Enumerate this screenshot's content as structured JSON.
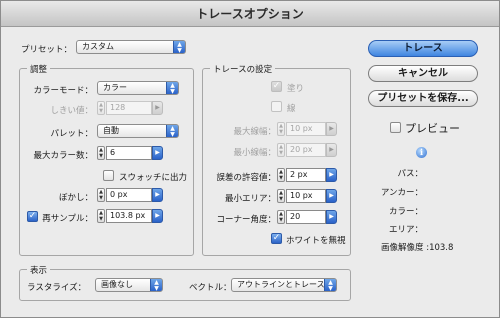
{
  "window": {
    "title": "トレースオプション"
  },
  "preset": {
    "label": "プリセット：",
    "value": "カスタム"
  },
  "adjust": {
    "title": "調整",
    "color_mode": {
      "label": "カラーモード：",
      "value": "カラー"
    },
    "threshold": {
      "label": "しきい値：",
      "value": "128"
    },
    "palette": {
      "label": "パレット：",
      "value": "自動"
    },
    "max_colors": {
      "label": "最大カラー数：",
      "value": "6"
    },
    "swatch_output": {
      "label": "スウォッチに出力",
      "checked": false
    },
    "blur": {
      "label": "ぼかし：",
      "value": "0 px"
    },
    "resample": {
      "label": "再サンプル：",
      "value": "103.8 px",
      "checked": true
    }
  },
  "trace_settings": {
    "title": "トレースの設定",
    "fill": {
      "label": "塗り",
      "checked": true
    },
    "stroke": {
      "label": "線",
      "checked": false
    },
    "max_stroke_weight": {
      "label": "最大線幅：",
      "value": "10 px"
    },
    "min_stroke_length": {
      "label": "最小線幅：",
      "value": "20 px"
    },
    "path_fitting": {
      "label": "誤差の許容値：",
      "value": "2 px"
    },
    "min_area": {
      "label": "最小エリア：",
      "value": "10 px"
    },
    "corner_angle": {
      "label": "コーナー角度：",
      "value": "20"
    },
    "ignore_white": {
      "label": "ホワイトを無視",
      "checked": true
    }
  },
  "view": {
    "title": "表示",
    "raster": {
      "label": "ラスタライズ：",
      "value": "画像なし"
    },
    "vector": {
      "label": "ベクトル：",
      "value": "アウトラインとトレース"
    }
  },
  "buttons": {
    "trace": "トレース",
    "cancel": "キャンセル",
    "save_preset": "プリセットを保存..."
  },
  "preview": {
    "label": "プレビュー",
    "checked": false
  },
  "info": {
    "paths": "パス：",
    "anchors": "アンカー：",
    "colors": "カラー：",
    "areas": "エリア：",
    "resolution": "画像解像度 :103.8"
  },
  "colors": {
    "accent": "#3f85e0",
    "window_bg": "#ebebeb"
  }
}
